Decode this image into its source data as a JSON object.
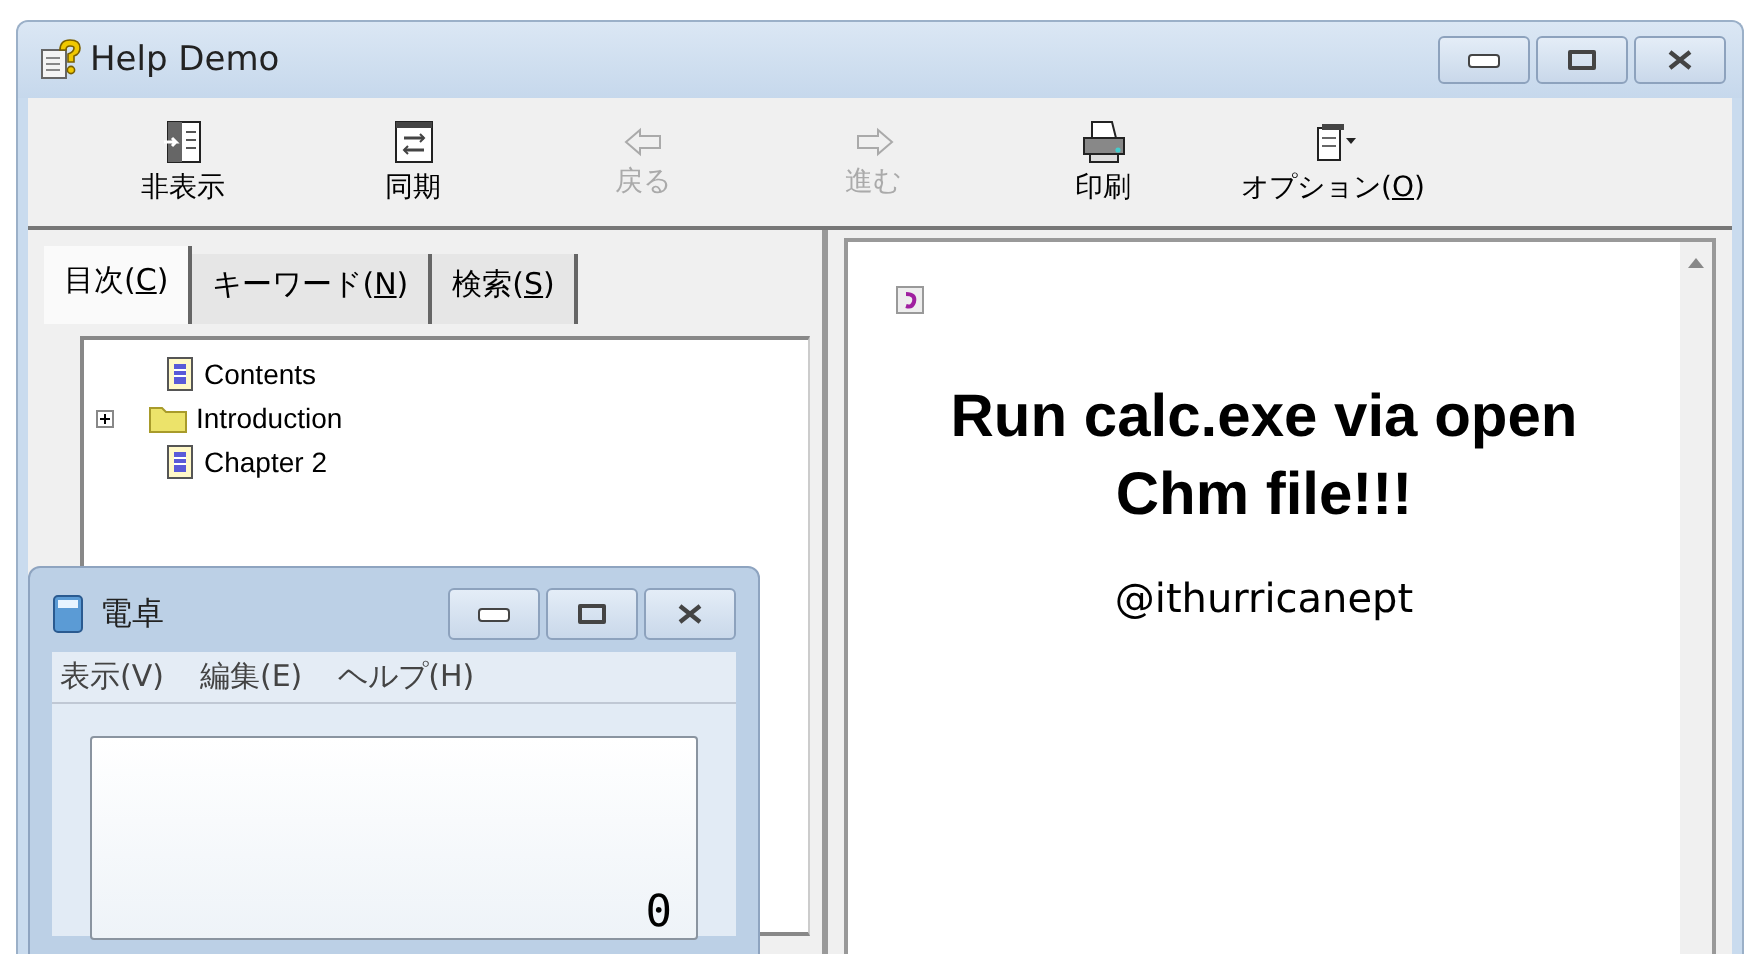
{
  "window": {
    "title": "Help Demo"
  },
  "toolbar": [
    {
      "label": "非表示",
      "kind": "hide",
      "disabled": false
    },
    {
      "label": "同期",
      "kind": "sync",
      "disabled": false
    },
    {
      "label": "戻る",
      "kind": "back",
      "disabled": true
    },
    {
      "label": "進む",
      "kind": "forward",
      "disabled": true
    },
    {
      "label": "印刷",
      "kind": "print",
      "disabled": false
    },
    {
      "before": "オプション(",
      "mnemonic": "O",
      "after": ")",
      "kind": "options",
      "disabled": false
    }
  ],
  "tabs": [
    {
      "before": "目次(",
      "mnemonic": "C",
      "after": ")",
      "selected": true
    },
    {
      "before": "キーワード(",
      "mnemonic": "N",
      "after": ")",
      "selected": false
    },
    {
      "before": "検索(",
      "mnemonic": "S",
      "after": ")",
      "selected": false
    }
  ],
  "tree": [
    {
      "label": "Contents",
      "kind": "page"
    },
    {
      "label": "Introduction",
      "kind": "folder",
      "expanded": false
    },
    {
      "label": "Chapter 2",
      "kind": "page"
    }
  ],
  "content": {
    "heading": "Run calc.exe via open Chm file!!!",
    "author": "@ithurricanept"
  },
  "calculator": {
    "title": "電卓",
    "menu": [
      "表示(V)",
      "編集(E)",
      "ヘルプ(H)"
    ],
    "display": "0"
  }
}
